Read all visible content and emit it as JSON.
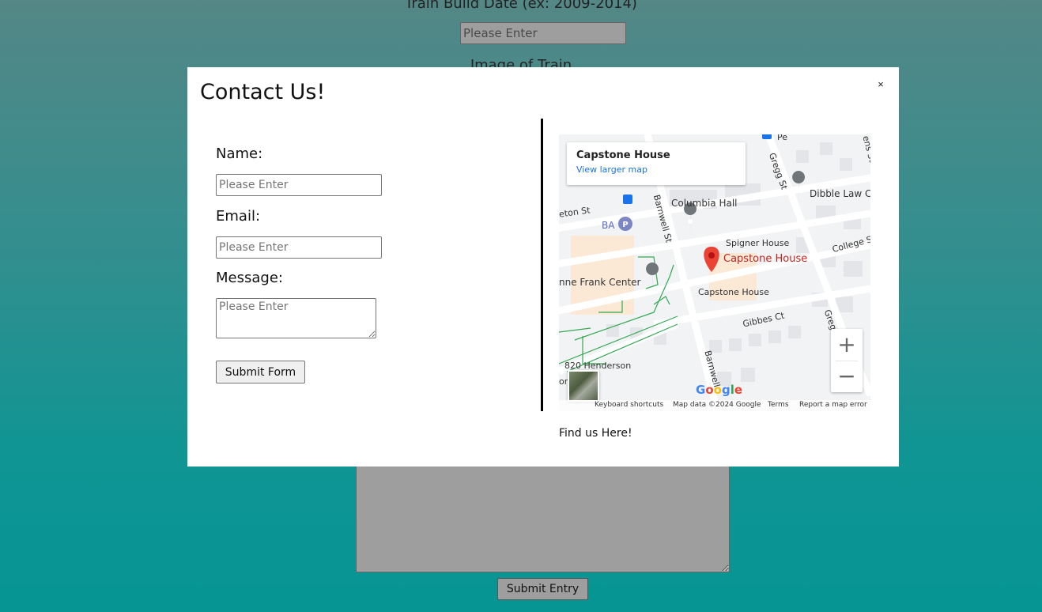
{
  "background": {
    "build_date_label": "Train Build Date (ex: 2009-2014)",
    "build_date_placeholder": "Please Enter",
    "image_label": "Image of Train",
    "submit_label": "Submit Entry"
  },
  "modal": {
    "title": "Contact Us!",
    "close_label": "×",
    "name_label": "Name:",
    "name_placeholder": "Please Enter",
    "email_label": "Email:",
    "email_placeholder": "Please Enter",
    "message_label": "Message:",
    "message_placeholder": "Please Enter",
    "submit_label": "Submit Form",
    "find_us": "Find us Here!"
  },
  "map": {
    "place_name": "Capstone House",
    "view_larger": "View larger map",
    "zoom_in": "+",
    "zoom_out": "−",
    "streets": [
      "Gregg St",
      "Barnwell St",
      "eton St",
      "College St",
      "Gibbes Ct",
      "Barnwell",
      "Greg",
      "ens St",
      "Pe"
    ],
    "pois": {
      "dibble": "Dibble Law C",
      "columbia_hall": "Columbia Hall",
      "ba": "BA",
      "spigner": "Spigner House",
      "capstone_red": "Capstone House",
      "anne_frank": "nne Frank Center",
      "capstone_grey": "Capstone House",
      "henderson": "820 Henderson",
      "ori": "ori"
    },
    "google": [
      "G",
      "o",
      "o",
      "g",
      "l",
      "e"
    ],
    "footer": {
      "shortcuts": "Keyboard shortcuts",
      "map_data": "Map data ©2024 Google",
      "terms": "Terms",
      "report": "Report a map error"
    },
    "colors": {
      "marker": "#ea4335",
      "road": "#ffffff",
      "block": "#e8eaed",
      "path": "#34a853",
      "link": "#1a73e8"
    }
  }
}
